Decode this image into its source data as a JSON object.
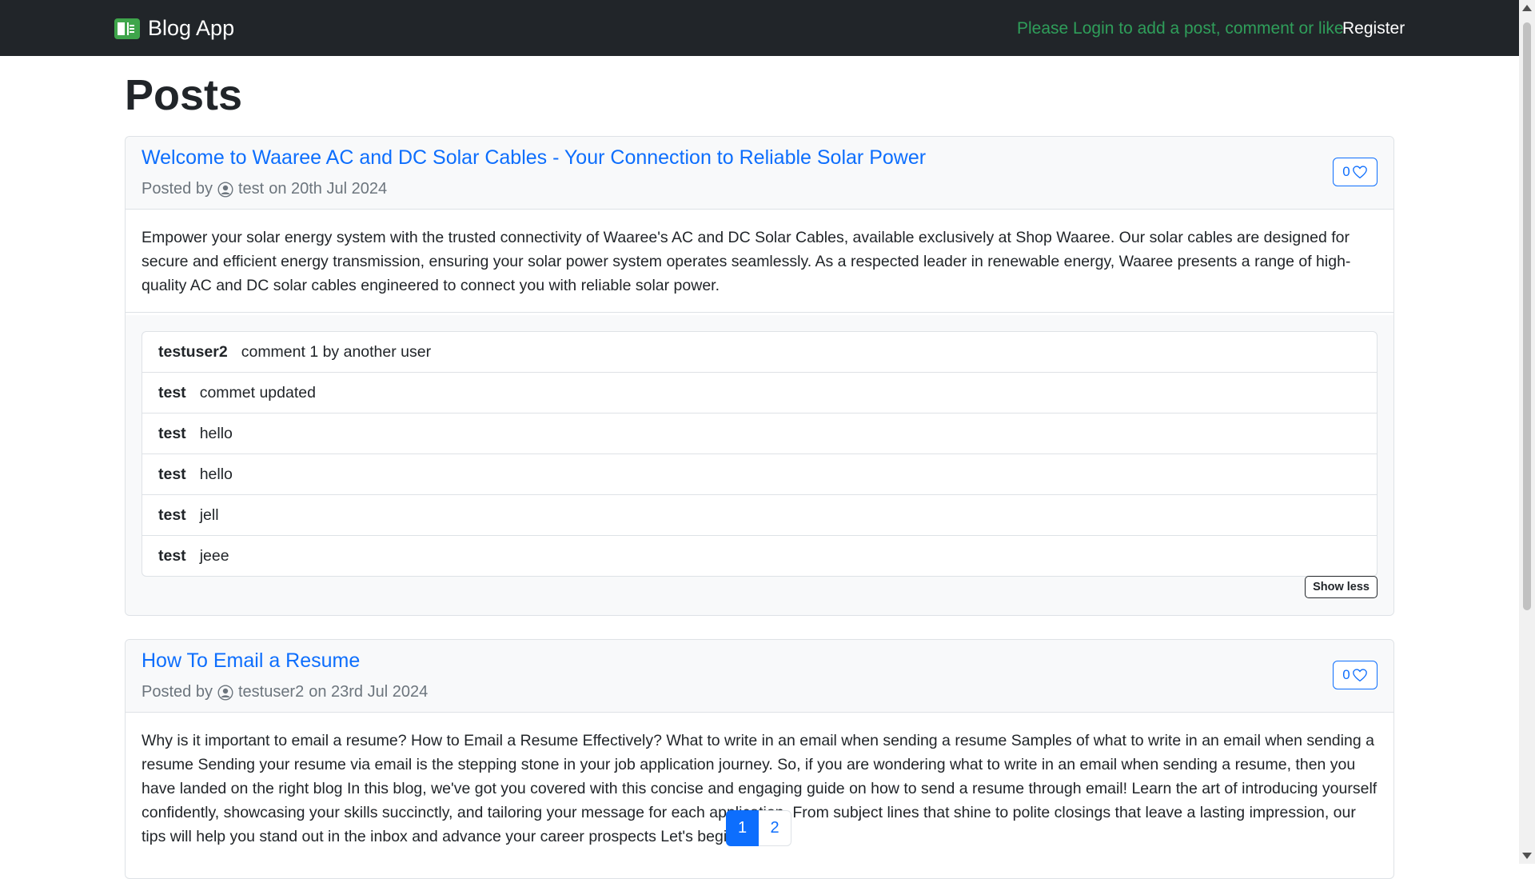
{
  "navbar": {
    "brand": "Blog App",
    "login_note": "Please Login to add a post, comment or like",
    "register": "Register"
  },
  "page": {
    "title": "Posts"
  },
  "posts": [
    {
      "title": "Welcome to Waaree AC and DC Solar Cables - Your Connection to Reliable Solar Power",
      "posted_by_label": "Posted by",
      "author": "test",
      "date": "on 20th Jul 2024",
      "likes": "0",
      "body": "Empower your solar energy system with the trusted connectivity of Waaree's AC and DC Solar Cables, available exclusively at Shop Waaree. Our solar cables are designed for secure and efficient energy transmission, ensuring your solar power system operates seamlessly. As a respected leader in renewable energy, Waaree presents a range of high-quality AC and DC solar cables engineered to connect you with reliable solar power.",
      "comments": [
        {
          "author": "testuser2",
          "text": "comment 1 by another user"
        },
        {
          "author": "test",
          "text": "commet updated"
        },
        {
          "author": "test",
          "text": "hello"
        },
        {
          "author": "test",
          "text": "hello"
        },
        {
          "author": "test",
          "text": "jell"
        },
        {
          "author": "test",
          "text": "jeee"
        }
      ],
      "show_less": "Show less"
    },
    {
      "title": "How To Email a Resume",
      "posted_by_label": "Posted by",
      "author": "testuser2",
      "date": "on 23rd Jul 2024",
      "likes": "0",
      "body": "Why is it important to email a resume? How to Email a Resume Effectively? What to write in an email when sending a resume Samples of what to write in an email when sending a resume Sending your resume via email is the stepping stone in your job application journey. So, if you are wondering what to write in an email when sending a resume, then you have landed on the right blog In this blog, we've got you covered with this concise and engaging guide on how to send a resume through email! Learn the art of introducing yourself confidently, showcasing your skills succinctly, and tailoring your message for each application. From subject lines that shine to polite closings that leave a lasting impression, our tips will help you stand out in the inbox and advance your career prospects Let's begin!"
    }
  ],
  "pagination": {
    "pages": [
      "1",
      "2"
    ],
    "active": "1"
  },
  "colors": {
    "navbar": "#212529",
    "link": "#0d6efd",
    "login_note": "#2f9e5a",
    "brand_logo": "#3fa54b"
  }
}
